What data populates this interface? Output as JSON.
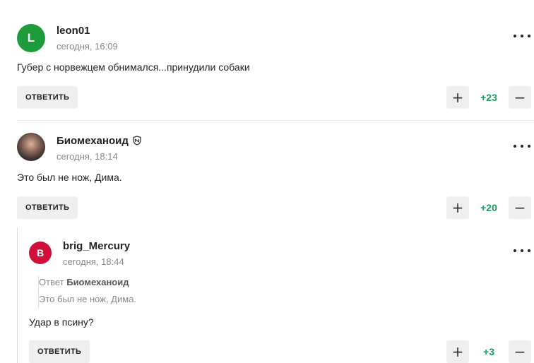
{
  "comments": [
    {
      "author": "leon01",
      "avatar_letter": "L",
      "avatar_color": "#1e9b3b",
      "time": "сегодня, 16:09",
      "text": "Губер с норвежцем обнимался...принудили собаки",
      "reply_label": "ОТВЕТИТЬ",
      "score": "+23"
    },
    {
      "author": "Биомеханоид",
      "avatar_letter": "",
      "avatar_color": "#5a4a44",
      "badge_icon": "nhl-shield-icon",
      "time": "сегодня, 18:14",
      "text": "Это был не нож, Дима.",
      "reply_label": "ОТВЕТИТЬ",
      "score": "+20"
    },
    {
      "author": "brig_Mercury",
      "avatar_letter": "B",
      "avatar_color": "#d0103a",
      "time": "сегодня, 18:44",
      "quote_prefix": "Ответ",
      "quote_author": "Биомеханоид",
      "quote_text": "Это был не нож, Дима.",
      "text": "Удар в псину?",
      "reply_label": "ОТВЕТИТЬ",
      "score": "+3"
    }
  ],
  "icons": {
    "plus": "+",
    "minus": "−"
  },
  "colors": {
    "score_positive": "#1a9b5b",
    "button_bg": "#efefef"
  }
}
